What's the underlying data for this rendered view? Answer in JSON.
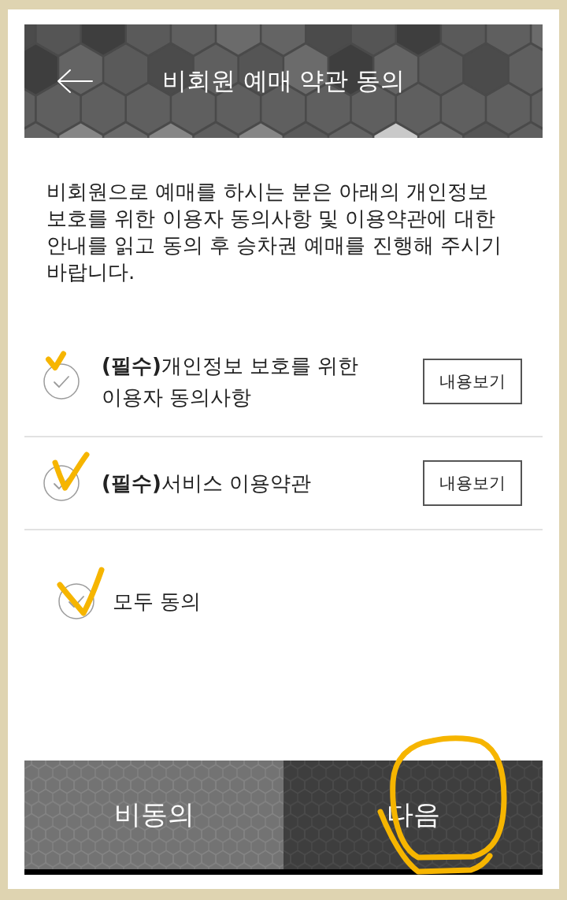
{
  "header": {
    "title": "비회원 예매 약관 동의"
  },
  "intro": "비회원으로 예매를 하시는 분은 아래의 개인정보 보호를 위한 이용자 동의사항 및 이용약관에 대한 안내를 읽고 동의 후 승차권 예매를 진행해 주시기 바랍니다.",
  "terms": [
    {
      "label": "**(필수)**개인정보 보호를 위한 이용자 동의사항",
      "checked": false,
      "annotated": true,
      "button": "내용보기"
    },
    {
      "label": "**(필수)**서비스 이용약관",
      "checked": false,
      "annotated": true,
      "button": "내용보기"
    }
  ],
  "agree_all": {
    "label": "모두 동의",
    "checked": false,
    "annotated": true
  },
  "buttons": [
    {
      "label": "비동의",
      "kind": "secondary",
      "circled": false
    },
    {
      "label": "다음",
      "kind": "primary",
      "circled": true
    }
  ]
}
